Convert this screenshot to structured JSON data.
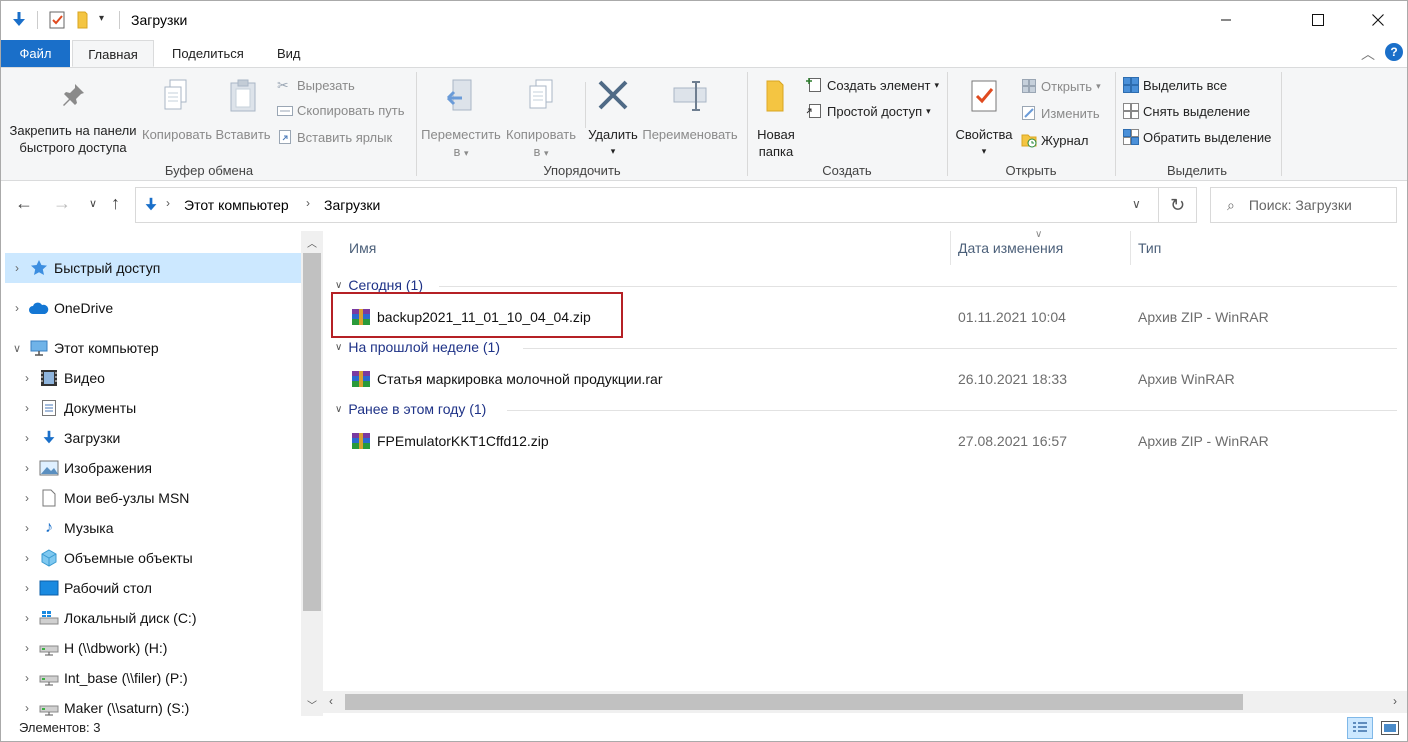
{
  "window": {
    "title": "Загрузки",
    "minimize_icon": "minimize-icon",
    "maximize_icon": "maximize-icon",
    "close_icon": "close-icon"
  },
  "tabs": [
    {
      "label": "Файл"
    },
    {
      "label": "Главная"
    },
    {
      "label": "Поделиться"
    },
    {
      "label": "Вид"
    }
  ],
  "ribbon": {
    "clipboard": {
      "pin_line1": "Закрепить на панели",
      "pin_line2": "быстрого доступа",
      "copy": "Копировать",
      "paste": "Вставить",
      "cut": "Вырезать",
      "copy_path": "Скопировать путь",
      "paste_shortcut": "Вставить ярлык",
      "label": "Буфер обмена"
    },
    "organize": {
      "move_line1": "Переместить",
      "move_line2": "в",
      "copy_line1": "Копировать",
      "copy_line2": "в",
      "delete": "Удалить",
      "rename": "Переименовать",
      "label": "Упорядочить"
    },
    "create": {
      "new_folder_line1": "Новая",
      "new_folder_line2": "папка",
      "new_item": "Создать элемент",
      "easy_access": "Простой доступ",
      "label": "Создать"
    },
    "open": {
      "properties": "Свойства",
      "open": "Открыть",
      "edit": "Изменить",
      "history": "Журнал",
      "label": "Открыть"
    },
    "select": {
      "select_all": "Выделить все",
      "select_none": "Снять выделение",
      "invert": "Обратить выделение",
      "label": "Выделить"
    }
  },
  "address": {
    "crumb1": "Этот компьютер",
    "crumb2": "Загрузки",
    "search_placeholder": "Поиск: Загрузки"
  },
  "nav": {
    "quick_access": "Быстрый доступ",
    "onedrive": "OneDrive",
    "this_pc": "Этот компьютер",
    "children": [
      "Видео",
      "Документы",
      "Загрузки",
      "Изображения",
      "Мои веб-узлы MSN",
      "Музыка",
      "Объемные объекты",
      "Рабочий стол",
      "Локальный диск (C:)",
      "H (\\\\dbwork) (H:)",
      "Int_base (\\\\filer) (P:)",
      "Maker (\\\\saturn) (S:)"
    ]
  },
  "columns": {
    "name": "Имя",
    "date": "Дата изменения",
    "type": "Тип"
  },
  "groups": [
    {
      "label": "Сегодня (1)",
      "files": [
        {
          "name": "backup2021_11_01_10_04_04.zip",
          "date": "01.11.2021 10:04",
          "type": "Архив ZIP - WinRAR"
        }
      ]
    },
    {
      "label": "На прошлой неделе (1)",
      "files": [
        {
          "name": "Статья маркировка молочной продукции.rar",
          "date": "26.10.2021 18:33",
          "type": "Архив WinRAR"
        }
      ]
    },
    {
      "label": "Ранее в этом году (1)",
      "files": [
        {
          "name": "FPEmulatorKKT1Cffd12.zip",
          "date": "27.08.2021 16:57",
          "type": "Архив ZIP - WinRAR"
        }
      ]
    }
  ],
  "status": {
    "items_count": "Элементов: 3"
  },
  "colors": {
    "accent": "#1a6fc9",
    "selection": "#cce8ff",
    "group_text": "#1e3287",
    "highlight_border": "#b52025"
  }
}
